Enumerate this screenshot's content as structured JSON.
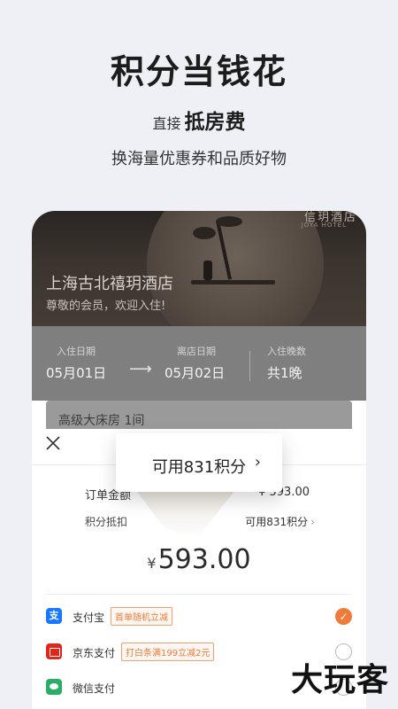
{
  "promo": {
    "title": "积分当钱花",
    "sub_prefix": "直接",
    "sub_emphasis": "抵房费",
    "desc": "换海量优惠券和品质好物"
  },
  "hotel": {
    "brand": "信玥酒店",
    "brand_en": "JOYA HOTEL",
    "name": "上海古北禧玥酒店",
    "welcome": "尊敬的会员，欢迎入住!"
  },
  "stay": {
    "checkin_label": "入住日期",
    "checkin_value": "05月01日",
    "checkout_label": "离店日期",
    "checkout_value": "05月02日",
    "nights_label": "入住晚数",
    "nights_value": "共1晚",
    "arrow": "⟶"
  },
  "room": {
    "name": "高级大床房 1间"
  },
  "sheet": {
    "close": "×",
    "order_total_label": "订单金额",
    "order_total_value": "¥ 593.00",
    "points_label": "积分抵扣",
    "points_value": "可用831积分",
    "points_chevron": "›",
    "amount_currency": "¥",
    "amount_value": "593.00"
  },
  "payments": [
    {
      "name": "支付宝",
      "tag": "首单随机立减",
      "selected": true,
      "check": "✓"
    },
    {
      "name": "京东支付",
      "tag": "打白条满199立减2元",
      "selected": false
    },
    {
      "name": "微信支付",
      "tag": "",
      "selected": false
    }
  ],
  "tooltip": {
    "text": "可用831积分",
    "chevron": "›"
  },
  "watermark": "大玩客",
  "colors": {
    "accent": "#f07a3a",
    "background": "#eef0f6"
  }
}
